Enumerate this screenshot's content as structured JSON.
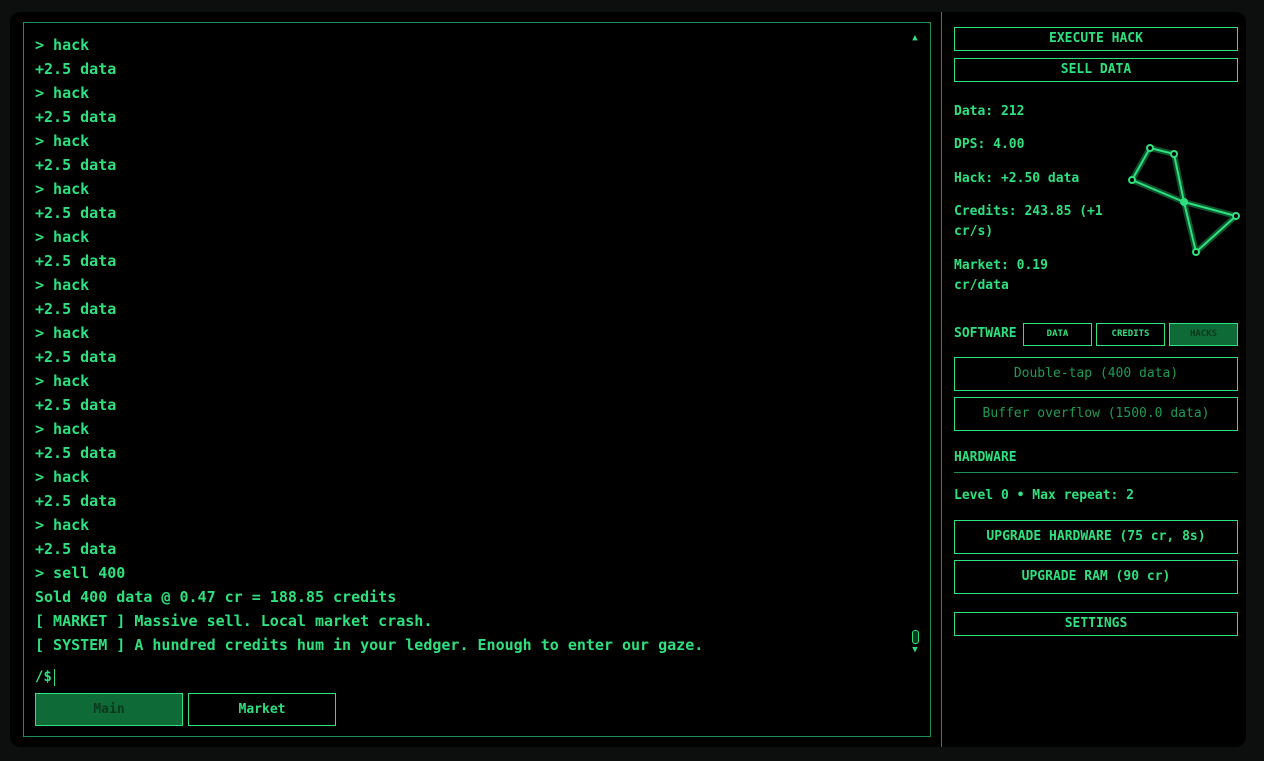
{
  "terminal": {
    "log": [
      "> hack",
      "+2.5 data",
      "> hack",
      "+2.5 data",
      "> hack",
      "+2.5 data",
      "> hack",
      "+2.5 data",
      "> hack",
      "+2.5 data",
      "> hack",
      "+2.5 data",
      "> hack",
      "+2.5 data",
      "> hack",
      "+2.5 data",
      "> hack",
      "+2.5 data",
      "> hack",
      "+2.5 data",
      "> hack",
      "+2.5 data",
      "> sell 400",
      "Sold 400 data @ 0.47 cr = 188.85 credits",
      "[ MARKET ] Massive sell. Local market crash.",
      "[ SYSTEM ] A hundred credits hum in your ledger. Enough to enter our gaze."
    ],
    "prompt": "/$",
    "tabs": [
      {
        "label": "Main",
        "active": true
      },
      {
        "label": "Market",
        "active": false
      }
    ]
  },
  "actions": {
    "execute_hack": "EXECUTE HACK",
    "sell_data": "SELL DATA"
  },
  "stats": {
    "data": "Data: 212",
    "dps": "DPS: 4.00",
    "hack": "Hack: +2.50 data",
    "credits_1": "Credits: 243.85 (+1",
    "credits_2": "cr/s)",
    "market_1": "Market: 0.19",
    "market_2": "cr/data"
  },
  "software": {
    "label": "SOFTWARE",
    "filters": [
      {
        "label": "DATA",
        "active": false
      },
      {
        "label": "CREDITS",
        "active": false
      },
      {
        "label": "HACKS",
        "active": true
      }
    ],
    "items": [
      "Double-tap (400 data)",
      "Buffer overflow (1500.0 data)"
    ]
  },
  "hardware": {
    "label": "HARDWARE",
    "level": "Level 0 • Max repeat: 2",
    "upgrade_hardware": "UPGRADE HARDWARE (75 cr, 8s)",
    "upgrade_ram": "UPGRADE RAM (90 cr)"
  },
  "settings": "SETTINGS",
  "colors": {
    "accent": "#23e07a",
    "active_fill": "#0e6a36",
    "background": "#000000"
  }
}
